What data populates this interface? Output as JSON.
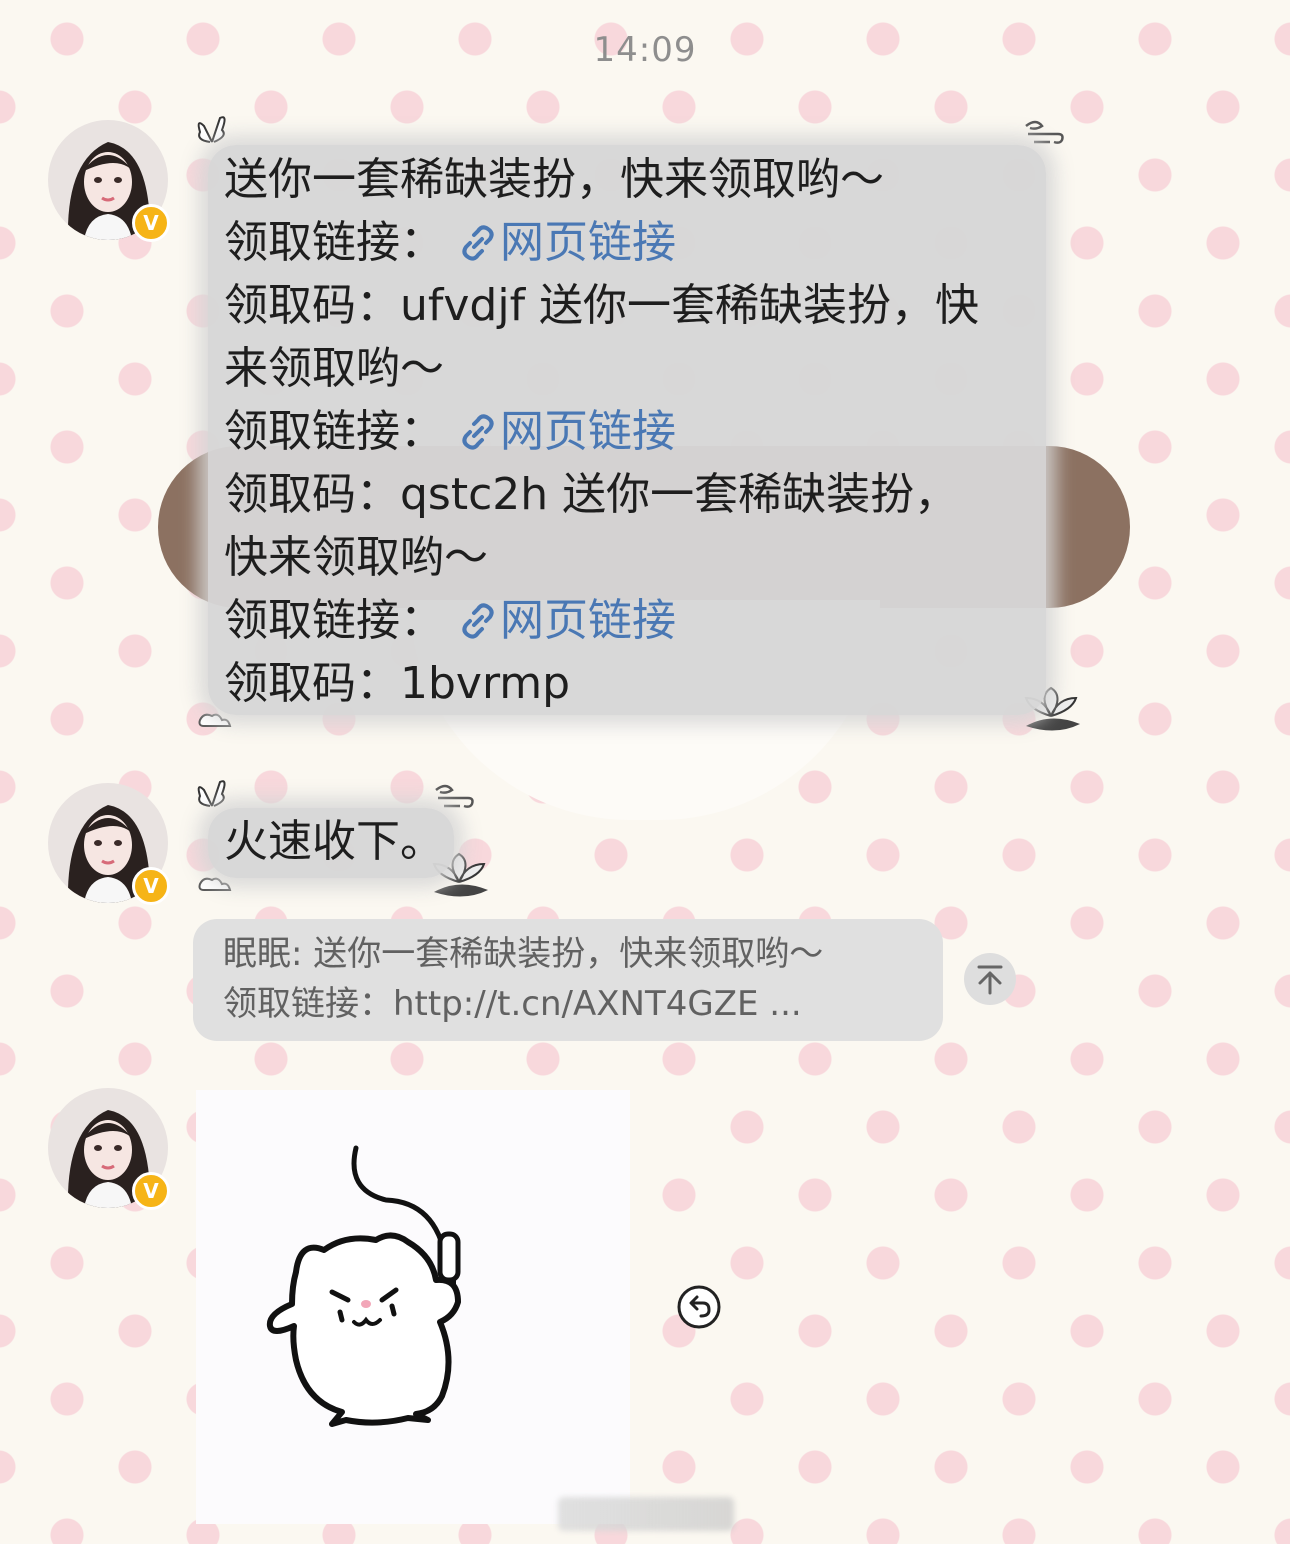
{
  "timestamp": "14:09",
  "messages": [
    {
      "type": "text",
      "lines": [
        {
          "text": "送你一套稀缺装扮，快来领取哟～"
        },
        {
          "prefix": "领取链接：",
          "link": "网页链接"
        },
        {
          "text": "领取码：ufvdjf 送你一套稀缺装扮，快"
        },
        {
          "text": "来领取哟～"
        },
        {
          "prefix": "领取链接：",
          "link": "网页链接"
        },
        {
          "text": "领取码：qstc2h 送你一套稀缺装扮，"
        },
        {
          "text": "快来领取哟～"
        },
        {
          "prefix": "领取链接：",
          "link": "网页链接"
        },
        {
          "text": "领取码：1bvrmp"
        }
      ]
    },
    {
      "type": "text",
      "text": "火速收下。"
    },
    {
      "type": "quote",
      "line1": "眠眠: 送你一套稀缺装扮，快来领取哟～",
      "line2": "领取链接：http://t.cn/AXNT4GZE ..."
    },
    {
      "type": "sticker",
      "description_icon": "hamster-mic-sticker"
    }
  ],
  "avatar": {
    "badge": "V",
    "verified_color": "#f6b417"
  },
  "icons": {
    "scroll_top": "arrow-up-bar-icon",
    "reply": "undo-arrow-icon",
    "link": "chain-link-icon"
  },
  "colors": {
    "link": "#4a78b4",
    "bubble": "#d6d6d6",
    "dots": "#f8d8dc"
  }
}
